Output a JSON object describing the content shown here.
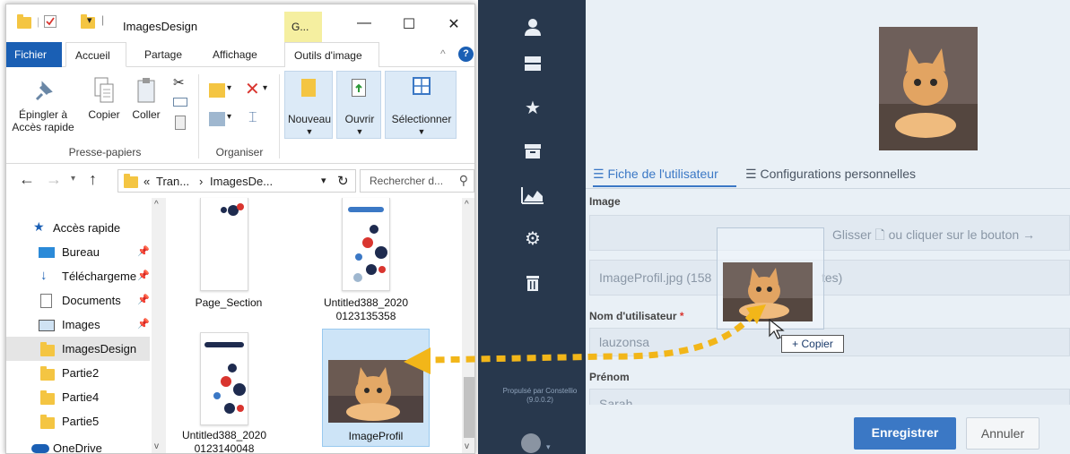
{
  "explorer": {
    "title": "ImagesDesign",
    "context_tab_head": "G...",
    "tabs": {
      "file": "Fichier",
      "home": "Accueil",
      "share": "Partage",
      "view": "Affichage",
      "image_tools": "Outils d'image"
    },
    "ribbon": {
      "pin_line1": "Épingler à",
      "pin_line2": "Accès rapide",
      "copy": "Copier",
      "paste": "Coller",
      "clipboard_group": "Presse-papiers",
      "organize_group": "Organiser",
      "new": "Nouveau",
      "open": "Ouvrir",
      "select": "Sélectionner"
    },
    "address": {
      "prefix": "«",
      "crumb1": "Tran...",
      "crumb2": "ImagesDe...",
      "search_placeholder": "Rechercher d..."
    },
    "nav": [
      {
        "label": "Accès rapide"
      },
      {
        "label": "Bureau"
      },
      {
        "label": "Téléchargeme"
      },
      {
        "label": "Documents"
      },
      {
        "label": "Images"
      },
      {
        "label": "ImagesDesign"
      },
      {
        "label": "Partie2"
      },
      {
        "label": "Partie4"
      },
      {
        "label": "Partie5"
      },
      {
        "label": "OneDrive"
      }
    ],
    "files": [
      {
        "name": "Page_Section"
      },
      {
        "name_line1": "Untitled388_2020",
        "name_line2": "0123135358"
      },
      {
        "name_line1": "Untitled388_2020",
        "name_line2": "0123140048"
      },
      {
        "name": "ImageProfil"
      }
    ]
  },
  "app": {
    "tabs": {
      "user_sheet": "Fiche de l'utilisateur",
      "personal_configs": "Configurations personnelles"
    },
    "image_label": "Image",
    "drop_hint_start": "Glisser",
    "drop_hint_end": "ou cliquer sur le bouton",
    "file_value_start": "ImageProfil.jpg (158",
    "file_value_end": "tes)",
    "username_label": "Nom d'utilisateur",
    "required_mark": "*",
    "username_value": "lauzonsa",
    "firstname_label": "Prénom",
    "firstname_value": "Sarah",
    "copy_tooltip": "+ Copier",
    "save_button": "Enregistrer",
    "cancel_button": "Annuler",
    "powered_line1": "Propulsé par Constellio",
    "powered_line2": "(9.0.0.2)"
  },
  "colors": {
    "sidebar_bg": "#28384d",
    "app_bg": "#e9f0f6",
    "accent": "#3b78c5",
    "drag_arrow": "#f2b619",
    "file_tab": "#1a5fb4"
  }
}
